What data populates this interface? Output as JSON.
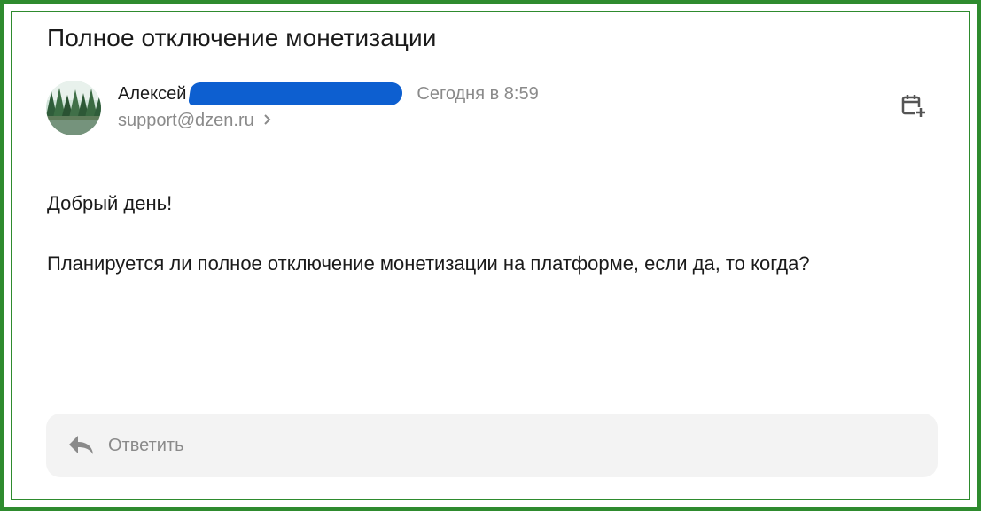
{
  "message": {
    "subject": "Полное отключение монетизации",
    "sender": {
      "name": "Алексей",
      "email": "support@dzen.ru",
      "date": "Сегодня в 8:59"
    },
    "body": [
      "Добрый день!",
      "Планируется ли полное отключение монетизации на платформе, если да, то когда?"
    ]
  },
  "reply": {
    "label": "Ответить"
  },
  "icons": {
    "calendar": "calendar-add-icon",
    "reply": "reply-arrow-icon",
    "chevron": "chevron-right-icon"
  },
  "colors": {
    "frame": "#2e8b2e",
    "redaction": "#0d5fd0",
    "muted_text": "#8a8a8a",
    "reply_bg": "#f3f3f3"
  }
}
